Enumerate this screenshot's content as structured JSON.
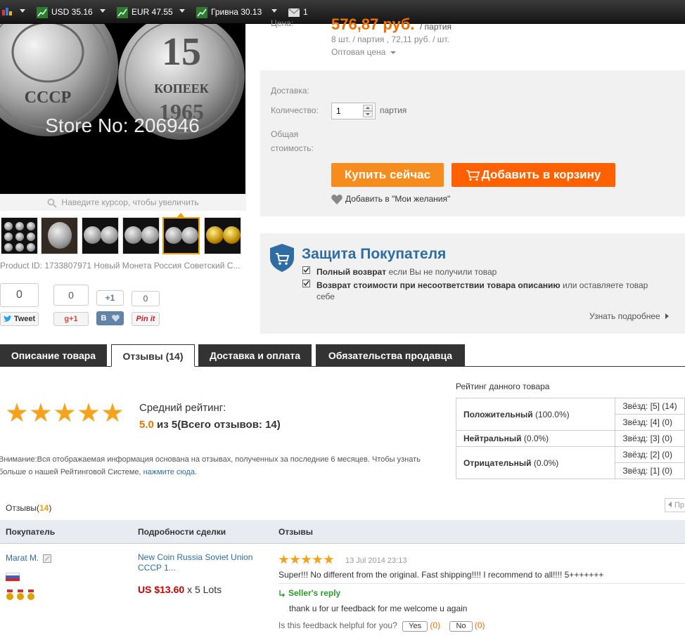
{
  "topbar": {
    "usd": "USD 35.16",
    "eur": "EUR 47.55",
    "uah": "Гривна 30.13",
    "mail_count": "1"
  },
  "image": {
    "watermark": "Store No: 206946",
    "coin_left_text": "СССР",
    "coin_right_value": "15",
    "coin_right_word": "КОПЕЕК",
    "coin_right_year": "1965",
    "zoom_hint": "Наведите курсор, чтобы увеличить"
  },
  "product_id": "Product ID: 1733807971 Новый Монета Россия Советский С...",
  "social": {
    "tweet_count": "0",
    "tweet_label": "Tweet",
    "gplus_count": "0",
    "gplus_label": "g+1",
    "vk_count": "+1",
    "vk_label": "B",
    "pin_count": "0",
    "pin_label": "Pin it"
  },
  "price": {
    "label": "Цена:",
    "value": "576,87 руб.",
    "unit": "/ партия",
    "detail": "8 шт. / партия , 72,11 руб. / шт.",
    "wholesale": "Оптовая цена"
  },
  "order": {
    "delivery_label": "Доставка:",
    "quantity_label": "Количество:",
    "quantity_value": "1",
    "quantity_unit": "партия",
    "total_label_1": "Общая",
    "total_label_2": "стоимость:",
    "buy_now": "Купить сейчас",
    "add_to_cart": "Добавить в корзину",
    "wishlist": "Добавить в \"Мои желания\""
  },
  "protection": {
    "title": "Защита Покупателя",
    "item1_bold": "Полный возврат",
    "item1_rest": "если Вы не получили товар",
    "item2_bold": "Возврат стоимости при несоответствии товара описанию",
    "item2_rest": "или оставляете товар",
    "item2_rest2": "себе",
    "more": "Узнать подробнее"
  },
  "tabs": [
    {
      "label": "Описание товара"
    },
    {
      "label": "Отзывы (14)"
    },
    {
      "label": "Доставка и оплата"
    },
    {
      "label": "Обязательства продавца"
    }
  ],
  "rating": {
    "stars": 5,
    "avg_label": "Средний рейтинг:",
    "score": "5.0",
    "of": "из 5(Всего отзывов: 14)",
    "notice_1": "Внимание:Вся отображаемая информация основана на отзывах, полученных за последние 6 месяцев. Чтобы узнать",
    "notice_2": "больше о нашей Рейтинговой Системе,",
    "notice_link": "нажмите сюда",
    "table_title": "Рейтинг данного товара",
    "positive_label": "Положительный",
    "positive_pct": "(100.0%)",
    "neutral_label": "Нейтральный",
    "neutral_pct": "(0.0%)",
    "negative_label": "Отрицательный",
    "negative_pct": "(0.0%)",
    "star5": "Звёзд: [5] (14)",
    "star4": "Звёзд: [4] (0)",
    "star3": "Звёзд: [3] (0)",
    "star2": "Звёзд: [2] (0)",
    "star1": "Звёзд: [1] (0)"
  },
  "reviews": {
    "label": "Отзывы(",
    "count": "14",
    "close": ")",
    "pager_prev": "Пр",
    "col_buyer": "Покупатель",
    "col_details": "Подробности сделки",
    "col_feedback": "Отзывы",
    "items": [
      {
        "buyer": "Marat M.",
        "product_1": "New Coin Russia Soviet Union",
        "product_2": "CCCP 1...",
        "price": "US $13.60",
        "qty": "x 5 Lots",
        "stars": 5,
        "date": "13 Jul 2014 23:13",
        "text": "Super!!! No different from the original. Fast shipping!!!! I recommend to all!!!! 5+++++++",
        "reply_label": "Seller's reply",
        "reply_text": "thank u for ur feedback for me welcome u again",
        "helpful_q": "Is this feedback helpful for you?",
        "yes": "Yes",
        "yes_count": "(0)",
        "no": "No",
        "no_count": "(0)"
      }
    ]
  }
}
